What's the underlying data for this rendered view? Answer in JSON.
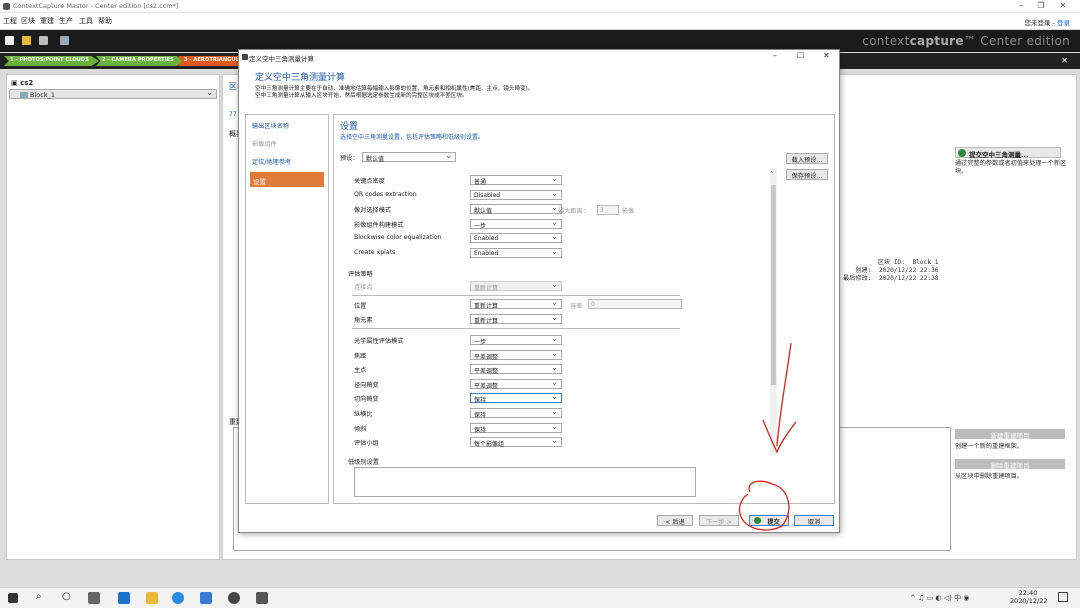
{
  "window": {
    "title": "ContextCapture Master - Center edition [cs2.ccm*]"
  },
  "menu": [
    "工程",
    "区块",
    "重建",
    "生产",
    "工具",
    "帮助"
  ],
  "login": {
    "prefix": "您未登录 - ",
    "link": "登录"
  },
  "brand": {
    "a": "context",
    "b": "capture",
    "tm": "™",
    "edition": " Center edition"
  },
  "steps": [
    "1 - PHOTOS/POINT CLOUDS",
    "2 - CAMERA PROPERTIES",
    "3 - AEROTRIANGUL"
  ],
  "tree": {
    "root": "cs2",
    "child": "Block_1"
  },
  "content": {
    "label_a": "区块",
    "label_b": "概要",
    "label_c": "重建",
    "prefix_77": "77",
    "submit_btn": "提交空中三角测量...",
    "submit_desc": "通过完整的参数或者初值来处理一个新区块。",
    "block_info": "区块 ID:  Block_1\n创建:  2020/12/22 22:36\n最后修改:  2020/12/22 22:38",
    "new_recon_btn": "新建重建项目",
    "new_recon_desc": "创建一个新的重建框架。",
    "del_recon_btn": "删除重建项目",
    "del_recon_desc": "从区块中删除重建项目。"
  },
  "dialog": {
    "title": "定义空中三角测量计算",
    "heading": "定义空中三角测量计算",
    "desc1": "空中三角测量计算主要在于自动、准确地估算每幅输入影像的位置、角元素和相机属性(焦距、主点、镜头畸变)。",
    "desc2": "空中三角测量计算从输入区块开始，然后根据选定参数生成新的完整区块或平差区块。",
    "nav": [
      "输出区块名称",
      "影像组件",
      "定位/地理参考",
      "设置"
    ],
    "panel_title": "设置",
    "panel_sub": "选择空中三角测量设置，包括评估策略和低级别设置。",
    "preset_label": "预设：",
    "preset_value": "默认值",
    "load_preset": "载入预设...",
    "save_preset": "保存预设...",
    "rows1": [
      {
        "label": "关键点密度",
        "value": "普通"
      },
      {
        "label": "QR codes extraction",
        "value": "Disabled"
      },
      {
        "label": "像对选择模式",
        "value": "默认值"
      },
      {
        "label": "影像组件构建模式",
        "value": "一步"
      },
      {
        "label": "Blockwise color equalization",
        "value": "Enabled"
      },
      {
        "label": "Create xplats",
        "value": "Enabled"
      }
    ],
    "max_dist_label": "最大距离：",
    "max_dist_value": "3",
    "max_dist_unit": "影像",
    "strategy_title": "评估策略",
    "tie_points": {
      "label": "连接点",
      "value": "重新计算"
    },
    "position": {
      "label": "位置",
      "value": "重新计算"
    },
    "tolerance_label": "容差",
    "tolerance_value": "0",
    "rotation": {
      "label": "角元素",
      "value": "重新计算"
    },
    "rows2": [
      {
        "label": "光学属性评估模式",
        "value": "一步"
      },
      {
        "label": "焦距",
        "value": "平差调整"
      },
      {
        "label": "主点",
        "value": "平差调整"
      },
      {
        "label": "径向畸变",
        "value": "平差调整"
      },
      {
        "label": "切向畸变",
        "value": "保持"
      },
      {
        "label": "纵横比",
        "value": "保持"
      },
      {
        "label": "倾斜",
        "value": "保持"
      },
      {
        "label": "评估小组",
        "value": "每个影像组"
      }
    ],
    "lowlevel_title": "低级别设置",
    "btn_back": "< 后退",
    "btn_next": "下一步 >",
    "btn_submit": "提交",
    "btn_cancel": "取消"
  },
  "taskbar": {
    "time": "22:40",
    "date": "2020/12/22"
  }
}
